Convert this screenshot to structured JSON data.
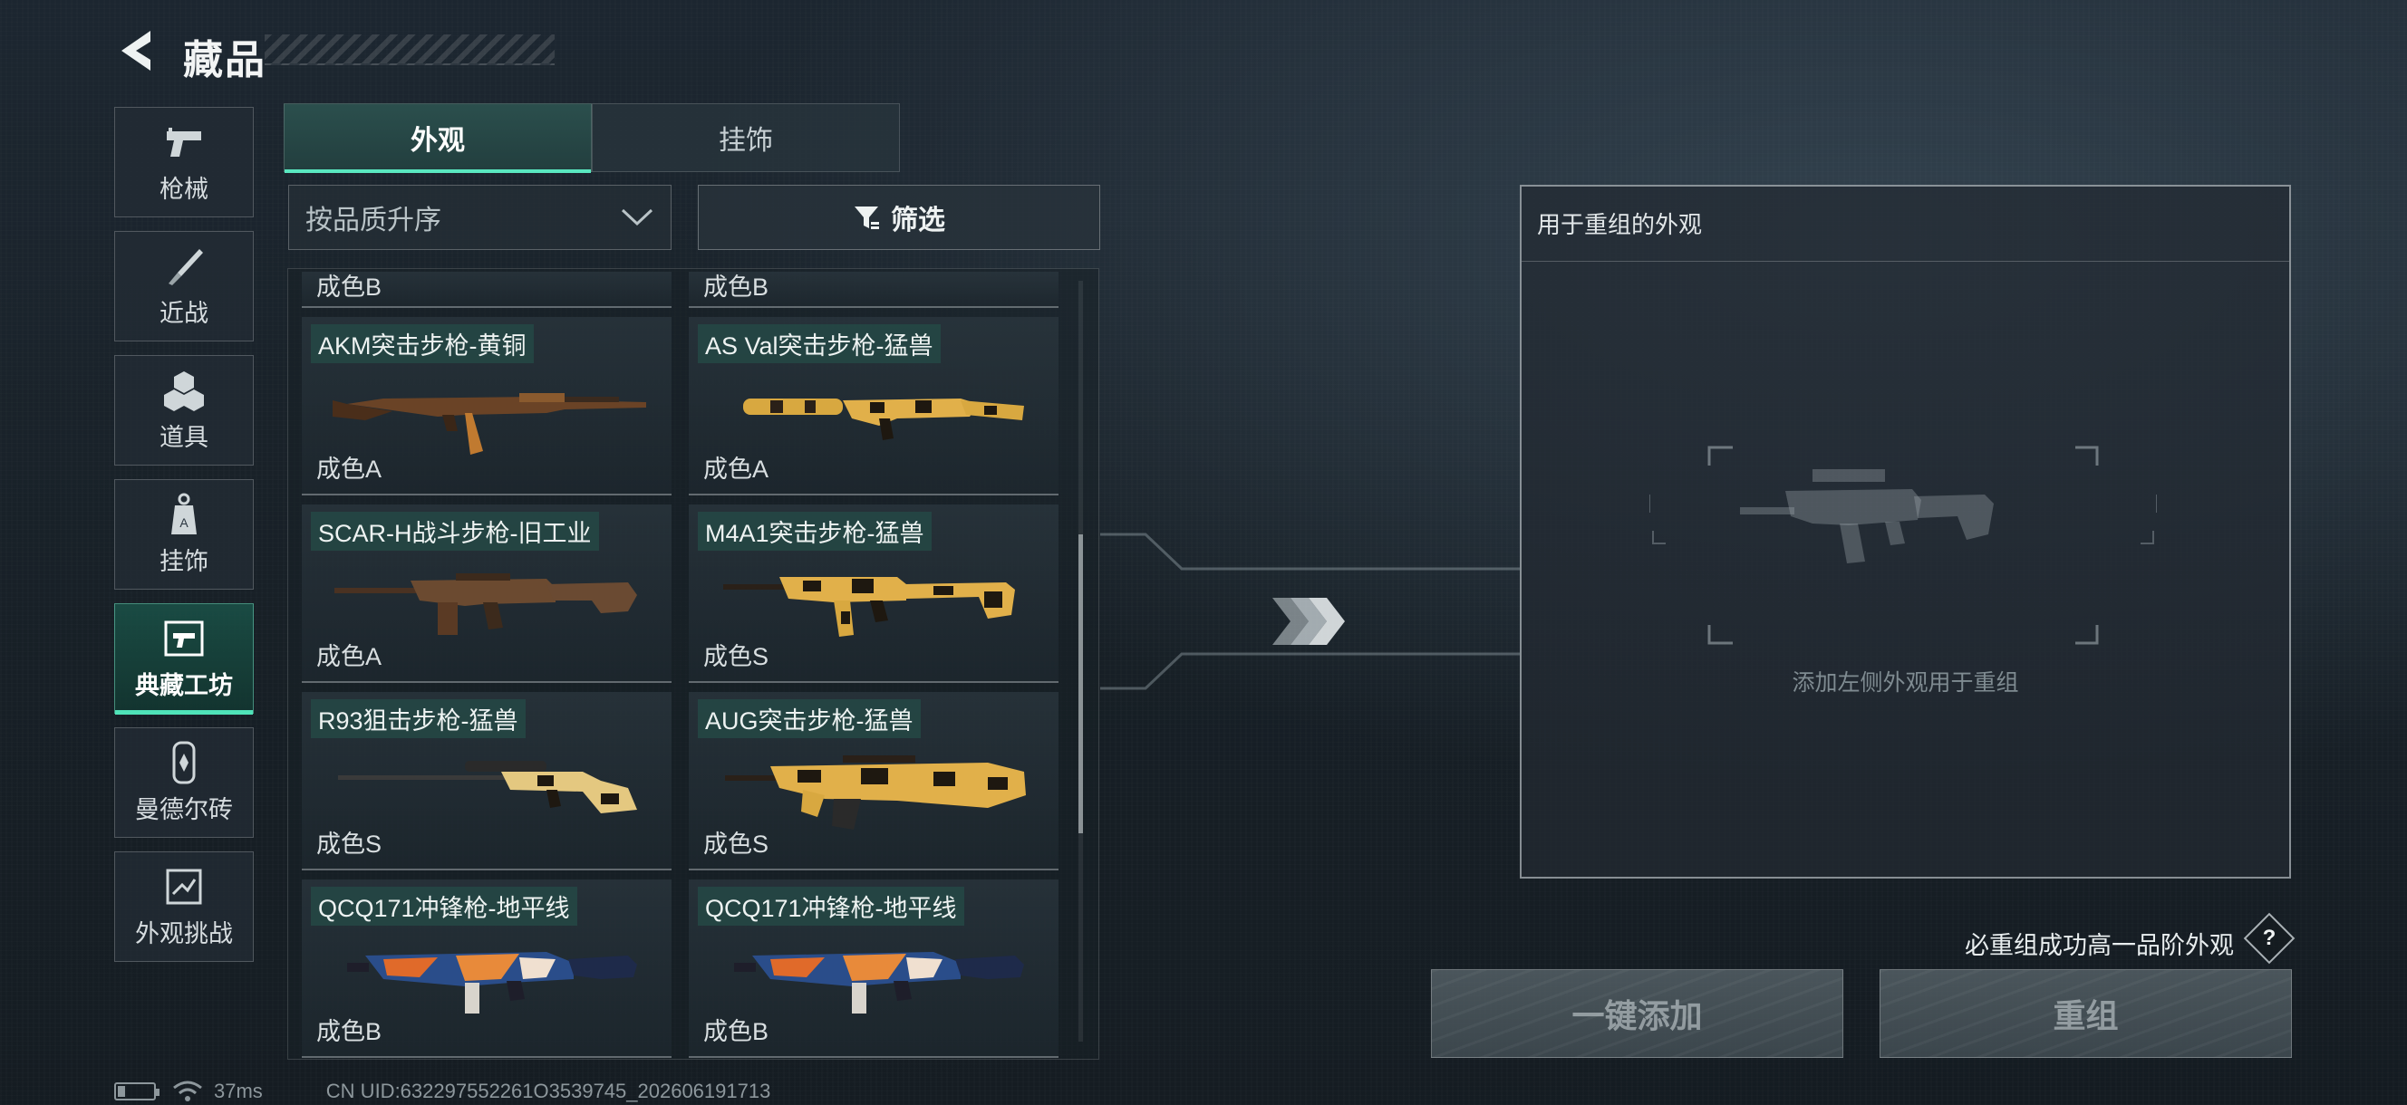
{
  "header": {
    "title": "藏品"
  },
  "categories": [
    {
      "label": "枪械",
      "icon": "pistol-icon"
    },
    {
      "label": "近战",
      "icon": "knife-icon"
    },
    {
      "label": "道具",
      "icon": "grenade-icon"
    },
    {
      "label": "挂饰",
      "icon": "charm-icon"
    },
    {
      "label": "典藏工坊",
      "icon": "workshop-icon",
      "active": true
    },
    {
      "label": "曼德尔砖",
      "icon": "mandel-brick-icon"
    },
    {
      "label": "外观挑战",
      "icon": "challenge-icon"
    }
  ],
  "tabs": [
    {
      "label": "外观",
      "active": true
    },
    {
      "label": "挂饰",
      "active": false
    }
  ],
  "sort": {
    "value": "按品质升序"
  },
  "filter": {
    "label": "筛选"
  },
  "skins": [
    {
      "name": "",
      "grade": "成色B"
    },
    {
      "name": "",
      "grade": "成色B"
    },
    {
      "name": "AKM突击步枪-黄铜",
      "grade": "成色A",
      "pattern": "brass"
    },
    {
      "name": "AS Val突击步枪-猛兽",
      "grade": "成色A",
      "pattern": "beast"
    },
    {
      "name": "SCAR-H战斗步枪-旧工业",
      "grade": "成色A",
      "pattern": "rust"
    },
    {
      "name": "M4A1突击步枪-猛兽",
      "grade": "成色S",
      "pattern": "beast"
    },
    {
      "name": "R93狙击步枪-猛兽",
      "grade": "成色S",
      "pattern": "beast"
    },
    {
      "name": "AUG突击步枪-猛兽",
      "grade": "成色S",
      "pattern": "beast"
    },
    {
      "name": "QCQ171冲锋枪-地平线",
      "grade": "成色B",
      "pattern": "horizon"
    },
    {
      "name": "QCQ171冲锋枪-地平线",
      "grade": "成色B",
      "pattern": "horizon"
    }
  ],
  "rework": {
    "title": "用于重组的外观",
    "hint": "添加左侧外观用于重组",
    "guarantee": "必重组成功高一品阶外观",
    "help": "?",
    "add_all_label": "一键添加",
    "rework_label": "重组"
  },
  "status": {
    "latency": "37ms",
    "uid": "CN UID:632297552261O3539745_202606191713"
  },
  "colors": {
    "accent": "#4fe3b8",
    "brass": "#b5823a",
    "beast_yellow": "#e2b24a",
    "horizon_orange": "#e06a2a",
    "horizon_blue": "#2a4d8a"
  }
}
